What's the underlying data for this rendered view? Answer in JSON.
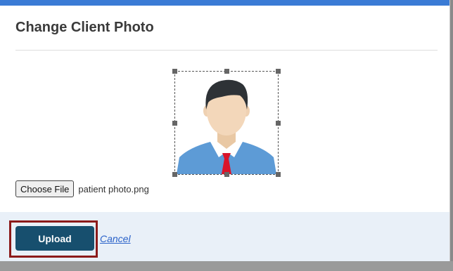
{
  "modal": {
    "title": "Change Client Photo",
    "accent_color": "#3a7bd5"
  },
  "photo": {
    "alt_icon": "avatar-placeholder-icon"
  },
  "file_input": {
    "button_label": "Choose File",
    "file_name": "patient photo.png"
  },
  "footer": {
    "upload_label": "Upload",
    "cancel_label": "Cancel",
    "upload_color": "#174f6e",
    "highlight_color": "#8b1a1a"
  }
}
